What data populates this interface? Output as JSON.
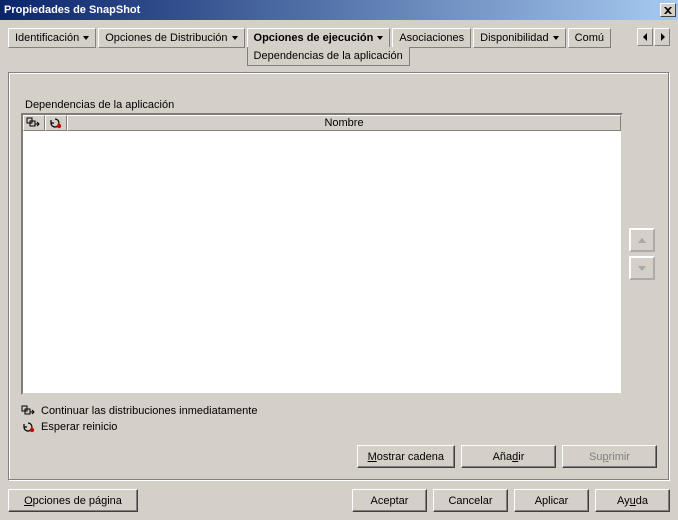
{
  "window": {
    "title": "Propiedades de SnapShot"
  },
  "tabs": {
    "items": [
      {
        "label": "Identificación"
      },
      {
        "label": "Opciones de Distribución"
      },
      {
        "label": "Opciones de ejecución",
        "subtab": "Dependencias de la aplicación"
      },
      {
        "label": "Asociaciones"
      },
      {
        "label": "Disponibilidad"
      },
      {
        "label": "Comú"
      }
    ]
  },
  "section": {
    "label": "Dependencias de la aplicación",
    "columns": {
      "name": "Nombre"
    }
  },
  "legend": {
    "continue": "Continuar las distribuciones inmediatamente",
    "wait": "Esperar reinicio"
  },
  "actions": {
    "show_chain_pre": "",
    "show_chain_mn": "M",
    "show_chain_post": "ostrar cadena",
    "add_pre": "Aña",
    "add_mn": "d",
    "add_post": "ir",
    "delete_pre": "Su",
    "delete_mn": "p",
    "delete_post": "rimir"
  },
  "dialog": {
    "page_options_pre": "",
    "page_options_mn": "O",
    "page_options_post": "pciones de página",
    "ok": "Aceptar",
    "cancel": "Cancelar",
    "apply": "Aplicar",
    "help_pre": "Ay",
    "help_mn": "u",
    "help_post": "da"
  }
}
